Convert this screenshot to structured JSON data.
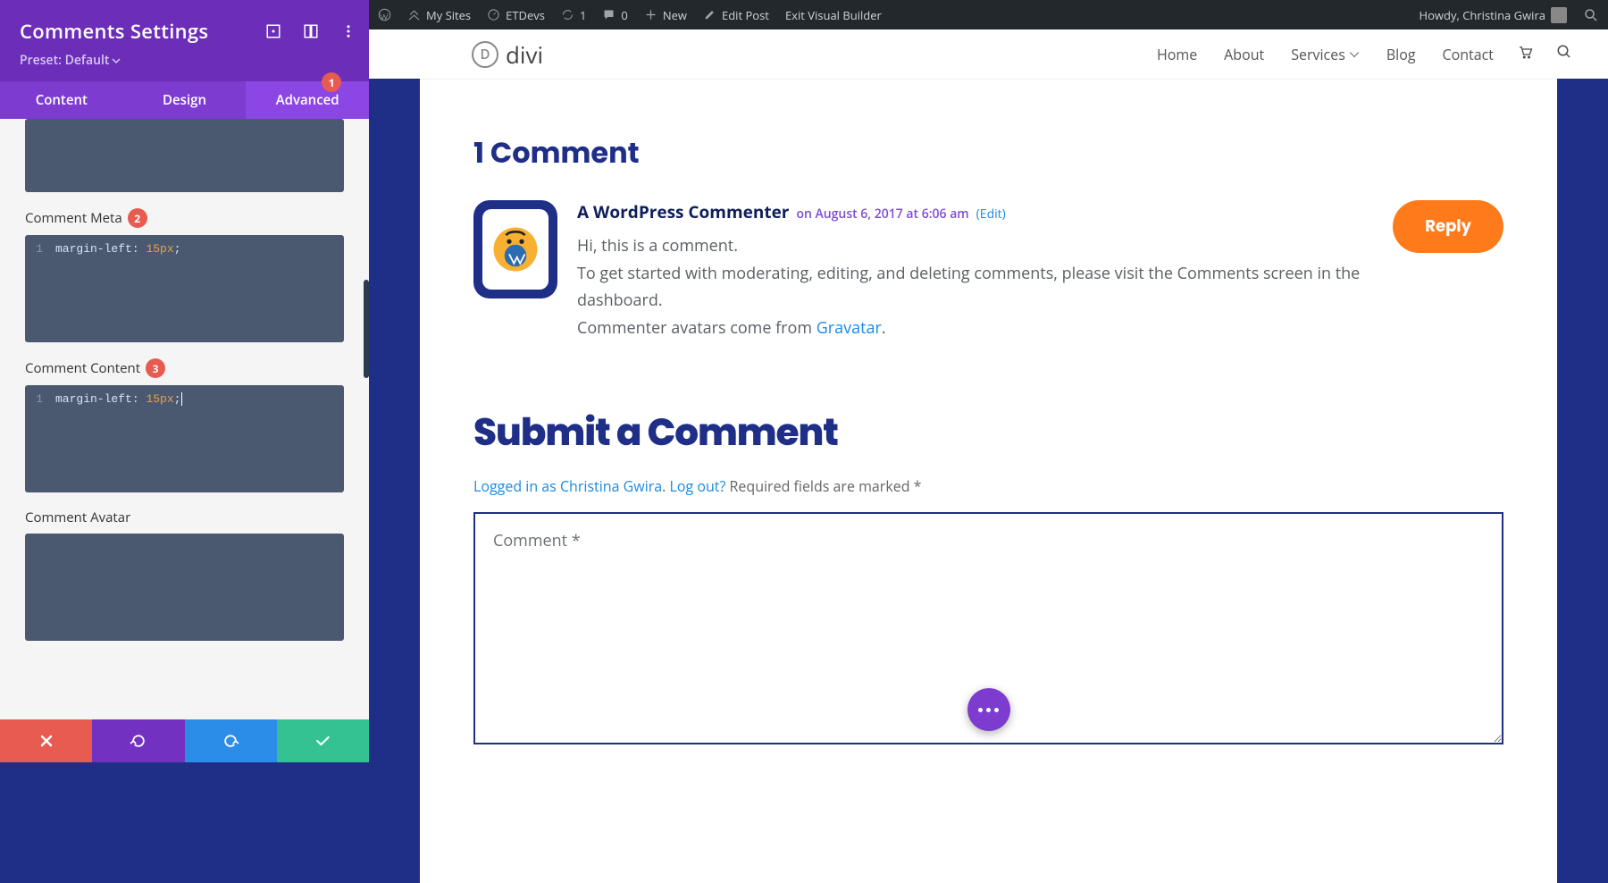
{
  "sidebar": {
    "title": "Comments Settings",
    "preset": "Preset: Default",
    "tabs": {
      "content": "Content",
      "design": "Design",
      "advanced": "Advanced",
      "advanced_badge": "1"
    },
    "sections": {
      "meta_label": "Comment Meta",
      "meta_badge": "2",
      "content_label": "Comment Content",
      "content_badge": "3",
      "avatar_label": "Comment Avatar"
    },
    "code": {
      "line_number": "1",
      "prop": "margin-left:",
      "val": "15px",
      "semicolon": ";"
    }
  },
  "wpbar": {
    "my_sites": "My Sites",
    "site_name": "ETDevs",
    "updates_count": "1",
    "comments_count": "0",
    "new": "New",
    "edit_post": "Edit Post",
    "exit_vb": "Exit Visual Builder",
    "howdy": "Howdy, Christina Gwira"
  },
  "nav": {
    "brand": "divi",
    "links": {
      "home": "Home",
      "about": "About",
      "services": "Services",
      "blog": "Blog",
      "contact": "Contact"
    }
  },
  "page": {
    "comments_heading": "1 Comment",
    "author": "A WordPress Commenter",
    "meta": "on August 6, 2017 at 6:06 am",
    "edit": "(Edit)",
    "body_l1": "Hi, this is a comment.",
    "body_l2": "To get started with moderating, editing, and deleting comments, please visit the Comments screen in the dashboard.",
    "body_l3a": "Commenter avatars come from ",
    "body_l3b": "Gravatar",
    "body_l3c": ".",
    "reply": "Reply",
    "submit_heading": "Submit a Comment",
    "logged_in": "Logged in as Christina Gwira",
    "logout": "Log out?",
    "required": " Required fields are marked *",
    "placeholder": "Comment *"
  }
}
